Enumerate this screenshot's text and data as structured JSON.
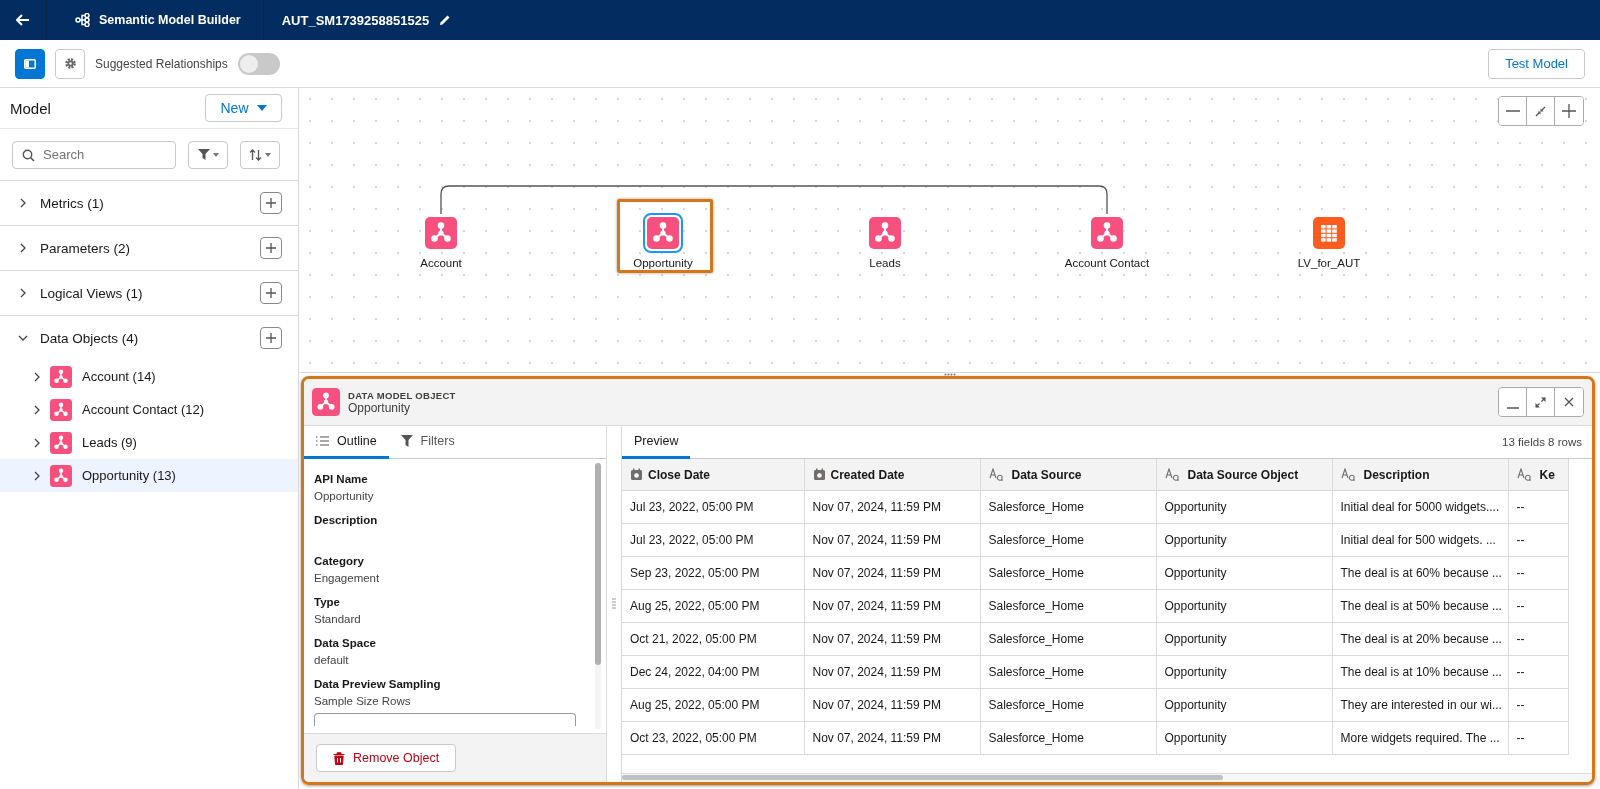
{
  "header": {
    "app_name": "Semantic Model Builder",
    "model_name": "AUT_SM1739258851525"
  },
  "toolbar": {
    "sidebar_toggle": {
      "selected": true
    },
    "suggested_relationships": {
      "label": "Suggested Relationships",
      "on": false
    },
    "test_button": "Test Model"
  },
  "sidebar": {
    "title": "Model",
    "new_button": "New",
    "search": {
      "placeholder": "Search"
    },
    "sections": [
      {
        "label": "Metrics (1)",
        "expanded": false
      },
      {
        "label": "Parameters (2)",
        "expanded": false
      },
      {
        "label": "Logical Views (1)",
        "expanded": false
      },
      {
        "label": "Data Objects (4)",
        "expanded": true,
        "children": [
          {
            "label": "Account (14)",
            "selected": false
          },
          {
            "label": "Account Contact (12)",
            "selected": false
          },
          {
            "label": "Leads (9)",
            "selected": false
          },
          {
            "label": "Opportunity (13)",
            "selected": true
          }
        ]
      }
    ]
  },
  "canvas": {
    "nodes": [
      {
        "label": "Account",
        "kind": "dmo",
        "selected": false,
        "linked": true
      },
      {
        "label": "Opportunity",
        "kind": "dmo",
        "selected": true,
        "linked": false
      },
      {
        "label": "Leads",
        "kind": "dmo",
        "selected": false,
        "linked": false
      },
      {
        "label": "Account Contact",
        "kind": "dmo",
        "selected": false,
        "linked": true
      },
      {
        "label": "LV_for_AUT",
        "kind": "logical_view",
        "selected": false,
        "linked": false
      }
    ]
  },
  "panel": {
    "type_label": "DATA MODEL OBJECT",
    "title": "Opportunity",
    "tabs": [
      {
        "label": "Outline",
        "kind": "outline",
        "selected": true
      },
      {
        "label": "Filters",
        "kind": "filter",
        "selected": false
      }
    ],
    "fields": [
      {
        "label": "API Name",
        "value": "Opportunity"
      },
      {
        "label": "Description"
      },
      {
        "label": "Category",
        "value": "Engagement"
      },
      {
        "label": "Type",
        "value": "Standard"
      },
      {
        "label": "Data Space",
        "value": "default"
      },
      {
        "label": "Data Preview Sampling",
        "value": "Sample Size Rows",
        "kind": "select"
      }
    ],
    "remove_button": "Remove Object",
    "preview": {
      "tab": {
        "label": "Preview",
        "selected": true
      },
      "summary": "13 fields 8 rows",
      "columns": [
        {
          "label": "Close Date",
          "kind": "date"
        },
        {
          "label": "Created Date",
          "kind": "date"
        },
        {
          "label": "Data Source",
          "kind": "text"
        },
        {
          "label": "Data Source Object",
          "kind": "text"
        },
        {
          "label": "Description",
          "kind": "text"
        },
        {
          "label": "Ke",
          "kind": "text"
        }
      ],
      "rows": [
        [
          "Jul 23, 2022, 05:00 PM",
          "Nov 07, 2024, 11:59 PM",
          "Salesforce_Home",
          "Opportunity",
          "Initial deal for 5000 widgets....",
          "--"
        ],
        [
          "Jul 23, 2022, 05:00 PM",
          "Nov 07, 2024, 11:59 PM",
          "Salesforce_Home",
          "Opportunity",
          "Initial deal for 500 widgets. ...",
          "--"
        ],
        [
          "Sep 23, 2022, 05:00 PM",
          "Nov 07, 2024, 11:59 PM",
          "Salesforce_Home",
          "Opportunity",
          "The deal is at 60% because ...",
          "--"
        ],
        [
          "Aug 25, 2022, 05:00 PM",
          "Nov 07, 2024, 11:59 PM",
          "Salesforce_Home",
          "Opportunity",
          "The deal is at 50% because ...",
          "--"
        ],
        [
          "Oct 21, 2022, 05:00 PM",
          "Nov 07, 2024, 11:59 PM",
          "Salesforce_Home",
          "Opportunity",
          "The deal is at 20% because ...",
          "--"
        ],
        [
          "Dec 24, 2022, 04:00 PM",
          "Nov 07, 2024, 11:59 PM",
          "Salesforce_Home",
          "Opportunity",
          "The deal is at 10% because ...",
          "--"
        ],
        [
          "Aug 25, 2022, 05:00 PM",
          "Nov 07, 2024, 11:59 PM",
          "Salesforce_Home",
          "Opportunity",
          "They are interested in our wi...",
          "--"
        ],
        [
          "Oct 23, 2022, 05:00 PM",
          "Nov 07, 2024, 11:59 PM",
          "Salesforce_Home",
          "Opportunity",
          "More widgets required. The ...",
          "--"
        ]
      ]
    }
  }
}
